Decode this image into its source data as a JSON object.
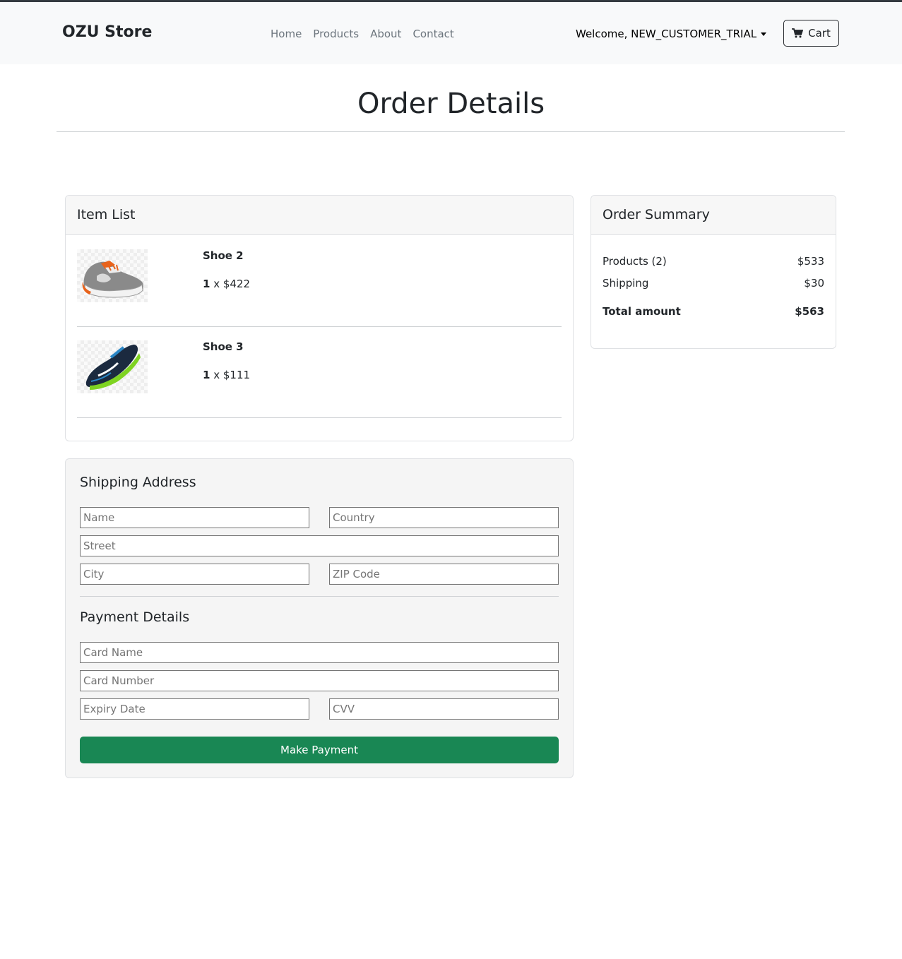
{
  "navbar": {
    "brand": "OZU Store",
    "links": [
      "Home",
      "Products",
      "About",
      "Contact"
    ],
    "welcome": "Welcome, NEW_CUSTOMER_TRIAL",
    "cart_label": "Cart"
  },
  "page": {
    "title": "Order Details"
  },
  "items": {
    "header": "Item List",
    "list": [
      {
        "name": "Shoe 2",
        "qty": "1",
        "sep": " x ",
        "price": "$422",
        "image_icon": "shoe-orange-gray-icon"
      },
      {
        "name": "Shoe 3",
        "qty": "1",
        "sep": " x ",
        "price": "$111",
        "image_icon": "shoe-blue-green-icon"
      }
    ]
  },
  "summary": {
    "header": "Order Summary",
    "products_label": "Products (2)",
    "products_value": "$533",
    "shipping_label": "Shipping",
    "shipping_value": "$30",
    "total_label": "Total amount",
    "total_value": "$563"
  },
  "shipping": {
    "title": "Shipping Address",
    "name_placeholder": "Name",
    "country_placeholder": "Country",
    "street_placeholder": "Street",
    "city_placeholder": "City",
    "zip_placeholder": "ZIP Code"
  },
  "payment": {
    "title": "Payment Details",
    "card_name_placeholder": "Card Name",
    "card_number_placeholder": "Card Number",
    "expiry_placeholder": "Expiry Date",
    "cvv_placeholder": "CVV",
    "button_label": "Make Payment"
  },
  "colors": {
    "accent_green": "#198754",
    "navbar_bg": "#f8f9fa"
  }
}
